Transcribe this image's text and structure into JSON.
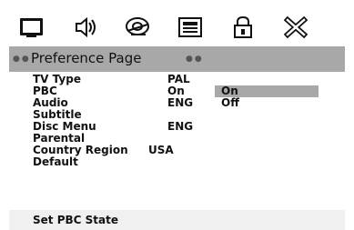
{
  "title": "Preference Page",
  "tabs": [
    {
      "icon": "tv-icon"
    },
    {
      "icon": "speaker-icon"
    },
    {
      "icon": "disc-icon"
    },
    {
      "icon": "preferences-icon"
    },
    {
      "icon": "lock-icon"
    },
    {
      "icon": "exit-icon"
    }
  ],
  "settings": [
    {
      "label": "TV Type",
      "value": "PAL"
    },
    {
      "label": "PBC",
      "value": "On"
    },
    {
      "label": "Audio",
      "value": "ENG"
    },
    {
      "label": "Subtitle",
      "value": ""
    },
    {
      "label": "Disc Menu",
      "value": "ENG"
    },
    {
      "label": "Parental",
      "value": ""
    },
    {
      "label": "Country Region",
      "value": "USA"
    },
    {
      "label": "Default",
      "value": ""
    }
  ],
  "options": [
    "On",
    "Off"
  ],
  "status": "Set PBC State"
}
